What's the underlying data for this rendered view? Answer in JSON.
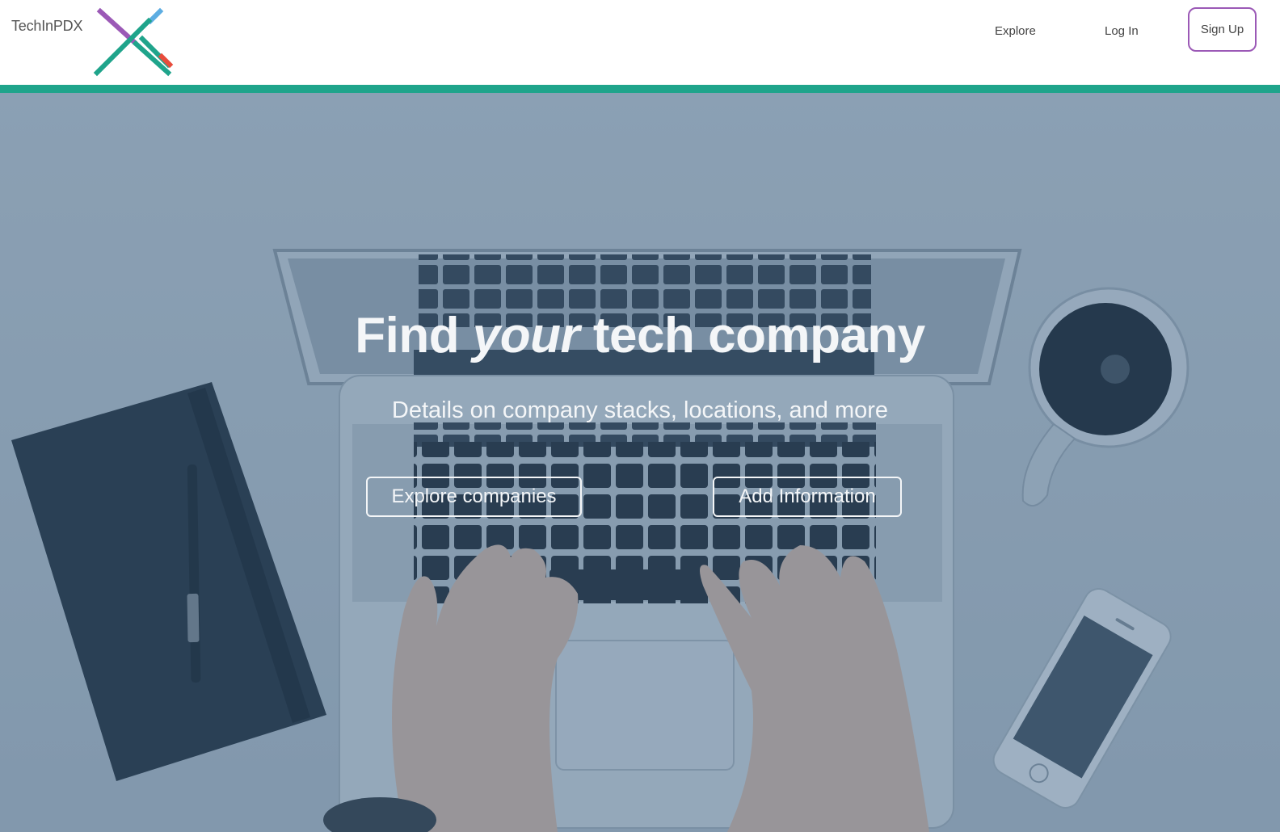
{
  "header": {
    "brand": "TechInPDX",
    "nav": {
      "explore": "Explore",
      "login": "Log In",
      "signup": "Sign Up"
    },
    "accent_color": "#1fa48b",
    "signup_border_color": "#9b59b6"
  },
  "hero": {
    "title_before": "Find ",
    "title_emphasis": "your",
    "title_after": " tech company",
    "subtitle": "Details on company stacks, locations, and more",
    "buttons": {
      "explore": "Explore companies",
      "add": "Add Information"
    },
    "background": "photo of hands typing on a laptop, notebook with pen, coffee mug, smartphone"
  },
  "logo": {
    "colors": {
      "purple": "#9b59b6",
      "teal": "#1fa48b",
      "blue": "#5dade2",
      "red": "#e74c3c"
    }
  }
}
